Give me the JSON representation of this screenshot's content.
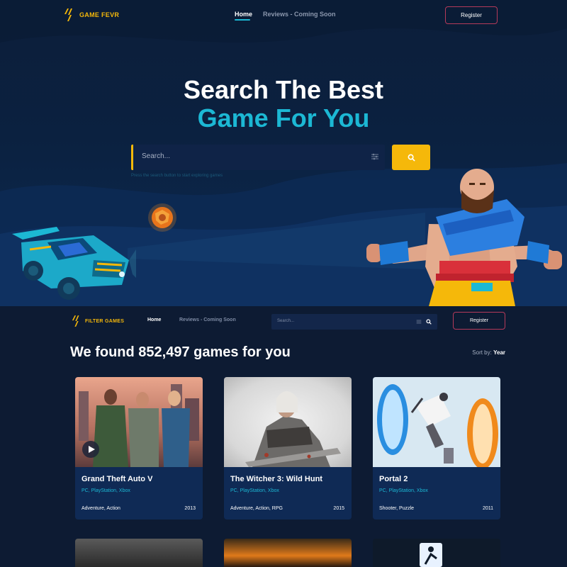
{
  "hero": {
    "logo": "GAME FEVR",
    "nav": {
      "home": "Home",
      "reviews": "Reviews - Coming Soon"
    },
    "register": "Register",
    "headline_line1": "Search The Best",
    "headline_line2": "Game For You",
    "search_placeholder": "Search...",
    "hint": "Press the search button to start exploring games"
  },
  "results": {
    "logo": "FILTER GAMES",
    "nav": {
      "home": "Home",
      "reviews": "Reviews - Coming Soon"
    },
    "search_placeholder": "Search...",
    "register": "Register",
    "found_text": "We found 852,497 games for you",
    "sort_label": "Sort by:",
    "sort_value": "Year",
    "cards": [
      {
        "title": "Grand Theft Auto V",
        "platforms": "PC, PlayStation, Xbox",
        "genres": "Adventure, Action",
        "year": "2013"
      },
      {
        "title": "The Witcher 3: Wild Hunt",
        "platforms": "PC, PlayStation, Xbox",
        "genres": "Adventure, Action, RPG",
        "year": "2015"
      },
      {
        "title": "Portal 2",
        "platforms": "PC, PlayStation, Xbox",
        "genres": "Shooter, Puzzle",
        "year": "2011"
      }
    ]
  },
  "colors": {
    "accent_yellow": "#f5b80a",
    "accent_cyan": "#1cb8d4",
    "background": "#0d1b33",
    "card": "#0f2a55",
    "register_border": "#b53a5a"
  },
  "icons": [
    "logo-slash-icon",
    "filter-sliders-icon",
    "search-icon",
    "play-icon"
  ]
}
